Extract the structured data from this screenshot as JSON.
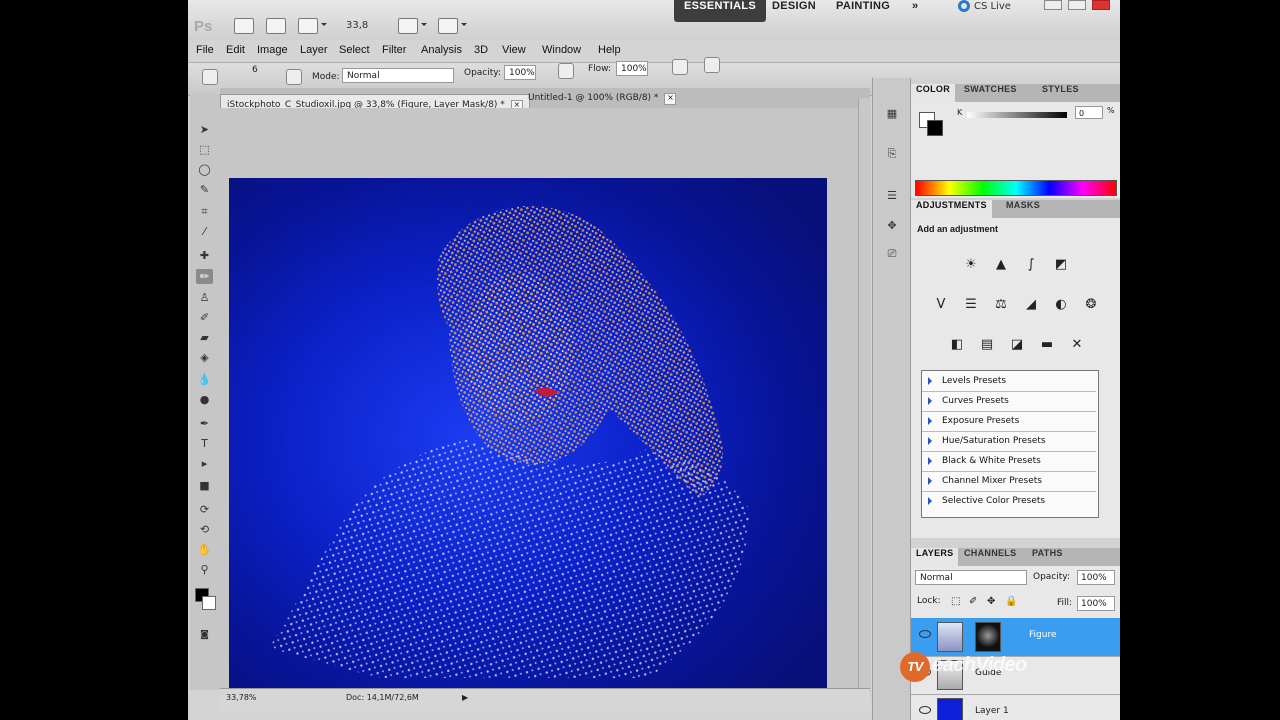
{
  "app": {
    "logo": "Ps",
    "zoom": "33,8",
    "workspaces": [
      "ESSENTIALS",
      "DESIGN",
      "PAINTING"
    ],
    "overflow_label": "»",
    "cs_live": "CS Live",
    "window_controls": [
      "minimize",
      "maximize",
      "close"
    ]
  },
  "menu": [
    "File",
    "Edit",
    "Image",
    "Layer",
    "Select",
    "Filter",
    "Analysis",
    "3D",
    "View",
    "Window",
    "Help"
  ],
  "options": {
    "brush_size": "6",
    "mode_label": "Mode:",
    "mode_value": "Normal",
    "opacity_label": "Opacity:",
    "opacity_value": "100%",
    "flow_label": "Flow:",
    "flow_value": "100%"
  },
  "doc_tabs": [
    {
      "title": "iStockphoto_C_Studioxil.jpg @ 33,8% (Figure, Layer Mask/8) *",
      "active": true
    },
    {
      "title": "Untitled-1 @ 100% (RGB/8) *",
      "active": false
    }
  ],
  "status": {
    "zoom": "33,78%",
    "doc": "Doc: 14,1M/72,6M"
  },
  "tools": [
    "move-tool",
    "marquee-tool",
    "lasso-tool",
    "quick-selection-tool",
    "crop-tool",
    "eyedropper-tool",
    "healing-brush-tool",
    "brush-tool",
    "clone-stamp-tool",
    "history-brush-tool",
    "eraser-tool",
    "gradient-tool",
    "blur-tool",
    "dodge-tool",
    "pen-tool",
    "type-tool",
    "path-selection-tool",
    "shape-tool",
    "3d-rotate-tool",
    "3d-orbit-tool",
    "hand-tool",
    "zoom-tool"
  ],
  "color_panel": {
    "tabs": [
      "COLOR",
      "SWATCHES",
      "STYLES"
    ],
    "channel": "K",
    "value": "0",
    "unit": "%"
  },
  "adjustments_panel": {
    "tabs": [
      "ADJUSTMENTS",
      "MASKS"
    ],
    "heading": "Add an adjustment",
    "presets": [
      "Levels Presets",
      "Curves Presets",
      "Exposure Presets",
      "Hue/Saturation Presets",
      "Black & White Presets",
      "Channel Mixer Presets",
      "Selective Color Presets"
    ]
  },
  "layers_panel": {
    "tabs": [
      "LAYERS",
      "CHANNELS",
      "PATHS"
    ],
    "blend_mode": "Normal",
    "opacity_label": "Opacity:",
    "opacity_value": "100%",
    "lock_label": "Lock:",
    "fill_label": "Fill:",
    "fill_value": "100%",
    "layers": [
      {
        "name": "Figure",
        "selected": true
      },
      {
        "name": "Guide",
        "selected": false
      },
      {
        "name": "Layer 1",
        "selected": false
      }
    ]
  },
  "watermark": {
    "badge": "TV",
    "text": "eachVideo"
  },
  "colors": {
    "selection_blue": "#3a9ef0",
    "active_workspace": "#3d3d3d",
    "canvas_blue": "#1b3cf2"
  }
}
